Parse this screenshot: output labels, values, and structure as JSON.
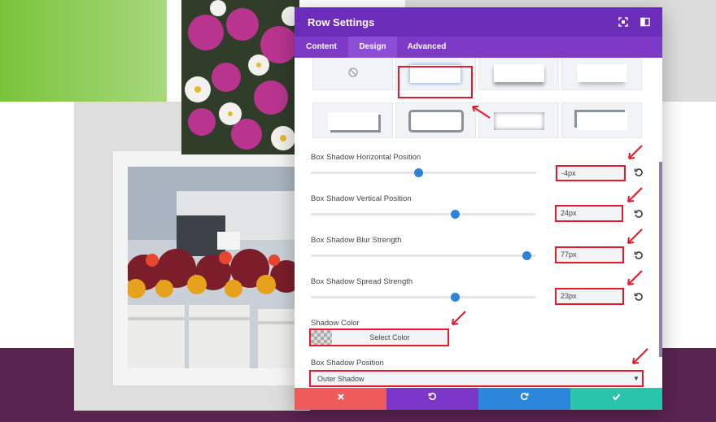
{
  "colors": {
    "header": "#6c2eb9",
    "tabs": "#7d3ac6",
    "accent_blue": "#2d83d6",
    "annotation_red": "#e8192c",
    "footer_cancel": "#ef5b5b",
    "footer_undo": "#7b37c8",
    "footer_redo": "#2b87da",
    "footer_save": "#29c4a9"
  },
  "modal": {
    "title": "Row Settings",
    "header_icons": [
      "fullscreen-icon",
      "sidebar-icon"
    ]
  },
  "tabs": [
    {
      "label": "Content",
      "active": false
    },
    {
      "label": "Design",
      "active": true
    },
    {
      "label": "Advanced",
      "active": false
    }
  ],
  "box_shadow_styles": {
    "selected_index": 1
  },
  "fields": [
    {
      "label": "Box Shadow Horizontal Position",
      "value": "-4px",
      "slider_fraction": 0.48
    },
    {
      "label": "Box Shadow Vertical Position",
      "value": "24px",
      "slider_fraction": 0.64
    },
    {
      "label": "Box Shadow Blur Strength",
      "value": "77px",
      "slider_fraction": 0.96
    },
    {
      "label": "Box Shadow Spread Strength",
      "value": "23px",
      "slider_fraction": 0.64
    }
  ],
  "shadow_color": {
    "label": "Shadow Color",
    "button": "Select Color"
  },
  "shadow_position": {
    "label": "Box Shadow Position",
    "selected": "Outer Shadow"
  },
  "footer": {
    "icons": [
      "close-icon",
      "undo-icon",
      "redo-icon",
      "check-icon"
    ]
  }
}
